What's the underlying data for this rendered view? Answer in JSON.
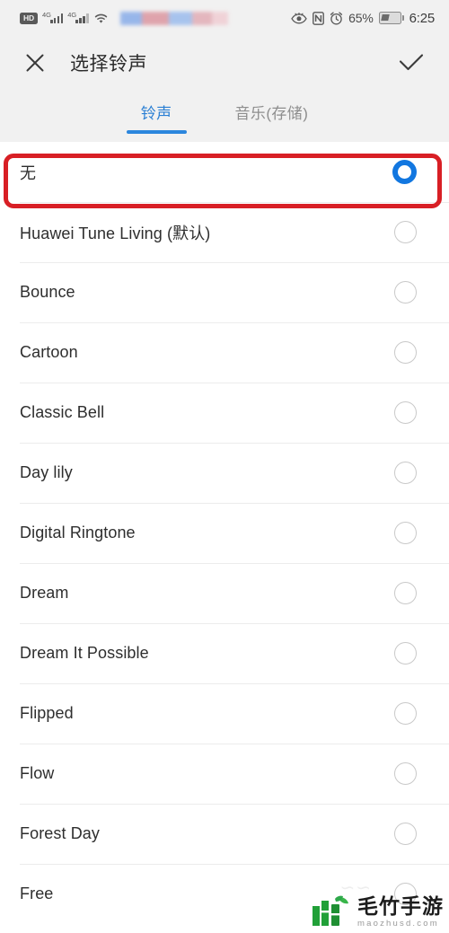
{
  "status_bar": {
    "hd_label": "HD",
    "network_gen_1": "4G",
    "network_gen_2": "4G",
    "wifi_icon": "wifi-icon",
    "redacted_carrier": "",
    "eye_icon": "eye-icon",
    "nfc_icon": "nfc-icon",
    "alarm_icon": "alarm-clock-icon",
    "battery_percent": "65%",
    "battery_icon": "battery-charging-icon",
    "time": "6:25"
  },
  "appbar": {
    "close_icon": "close-icon",
    "title": "选择铃声",
    "confirm_icon": "check-icon"
  },
  "tabs": [
    {
      "label": "铃声",
      "active": true
    },
    {
      "label": "音乐(存储)",
      "active": false
    }
  ],
  "colors": {
    "accent_blue": "#1277e0",
    "tab_active": "#2a7fd4",
    "tab_underline": "#2b86dd",
    "annotation_red": "#d81f25",
    "header_bg": "#f1f1f1",
    "list_bg": "#ffffff",
    "divider": "#ececec",
    "radio_border": "#c9c9c9",
    "watermark_green": "#21a038"
  },
  "ringtones": [
    {
      "name": "无",
      "selected": true
    },
    {
      "name": "Huawei Tune Living (默认)",
      "selected": false
    },
    {
      "name": "Bounce",
      "selected": false
    },
    {
      "name": "Cartoon",
      "selected": false
    },
    {
      "name": "Classic Bell",
      "selected": false
    },
    {
      "name": "Day lily",
      "selected": false
    },
    {
      "name": "Digital Ringtone",
      "selected": false
    },
    {
      "name": "Dream",
      "selected": false
    },
    {
      "name": "Dream It Possible",
      "selected": false
    },
    {
      "name": "Flipped",
      "selected": false
    },
    {
      "name": "Flow",
      "selected": false
    },
    {
      "name": "Forest Day",
      "selected": false
    },
    {
      "name": "Free",
      "selected": false
    }
  ],
  "watermark": {
    "name": "毛竹手游",
    "url": "maozhusd.com"
  }
}
